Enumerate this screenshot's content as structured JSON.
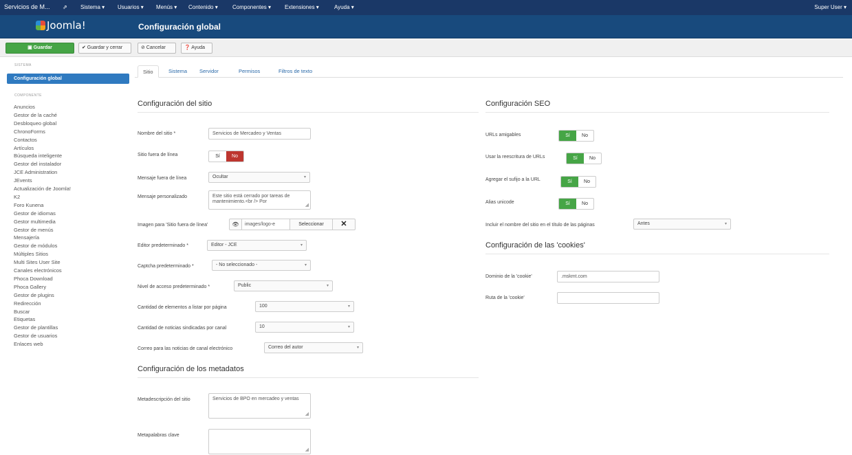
{
  "navbar": {
    "site_name": "Servicios de M... ",
    "external_icon": "external-link-icon",
    "menus": [
      "Sistema ▾",
      "Usuarios ▾",
      "Menús ▾",
      "Contenido ▾",
      "Componentes ▾",
      "Extensiones ▾",
      "Ayuda ▾"
    ],
    "user": "Super User ▾"
  },
  "header": {
    "logo_text": "Joomla!",
    "title": "Configuración global"
  },
  "toolbar": {
    "save": "Guardar",
    "save_close": "✔ Guardar y cerrar",
    "cancel": "⊘ Cancelar",
    "help": "❓ Ayuda"
  },
  "sidebar": {
    "system_head": "SISTEMA",
    "active": "Configuración global",
    "component_head": "COMPONENTE",
    "items": [
      "Anuncios",
      "Gestor de la caché",
      "Desbloqueo global",
      "ChronoForms",
      "Contactos",
      "Artículos",
      "Búsqueda inteligente",
      "Gestor del instalador",
      "JCE Administration",
      "JEvents",
      "Actualización de Joomla!",
      "K2",
      "Foro Kunena",
      "Gestor de idiomas",
      "Gestor multimedia",
      "Gestor de menús",
      "Mensajería",
      "Gestor de módulos",
      "Múltiples Sitios",
      "Multi Sites User Site",
      "Canales electrónicos",
      "Phoca Download",
      "Phoca Gallery",
      "Gestor de plugins",
      "Redirección",
      "Buscar",
      "Etiquetas",
      "Gestor de plantillas",
      "Gestor de usuarios",
      "Enlaces web"
    ]
  },
  "tabs": [
    "Sitio",
    "Sistema",
    "Servidor",
    "Permisos",
    "Filtros de texto"
  ],
  "site": {
    "heading": "Configuración del sitio",
    "name_label": "Nombre del sitio *",
    "name_value": "Servicios de Mercadeo y Ventas",
    "offline_label": "Sitio fuera de línea",
    "offline_yes": "Sí",
    "offline_no": "No",
    "offline_msg_label": "Mensaje fuera de línea",
    "offline_msg_value": "Ocultar",
    "custom_msg_label": "Mensaje personalizado",
    "custom_msg_value": "Este sitio está cerrado por tareas de mantenimiento.<br /> Por",
    "offline_img_label": "Imagen para 'Sitio fuera de línea'",
    "offline_img_path": "images/logo-e",
    "offline_img_select": "Seleccionar",
    "editor_label": "Editor predeterminado *",
    "editor_value": "Editor - JCE",
    "captcha_label": "Captcha predeterminado *",
    "captcha_value": "- No seleccionado -",
    "access_label": "Nivel de acceso predeterminado *",
    "access_value": "Public",
    "list_label": "Cantidad de elementos a listar por página",
    "list_value": "100",
    "feed_label": "Cantidad de noticias sindicadas por canal",
    "feed_value": "10",
    "email_label": "Correo para las noticias de canal electrónico",
    "email_value": "Correo del autor"
  },
  "meta": {
    "heading": "Configuración de los metadatos",
    "desc_label": "Metadescripción del sitio",
    "desc_value": "Servicios de BPO en mercadeo y ventas",
    "keywords_label": "Metapalabras clave"
  },
  "seo": {
    "heading": "Configuración SEO",
    "yes": "Sí",
    "no": "No",
    "friendly_label": "URLs amigables",
    "rewrite_label": "Usar la reescritura de URLs",
    "suffix_label": "Agregar el sufijo a la URL",
    "unicode_label": "Alias unicode",
    "sitename_label": "Incluir el nombre del sitio en el título de las páginas",
    "sitename_value": "Antes"
  },
  "cookies": {
    "heading": "Configuración de las 'cookies'",
    "domain_label": "Dominio de la 'cookie'",
    "domain_value": ".mskmt.com",
    "path_label": "Ruta de la 'cookie'",
    "path_value": ""
  }
}
